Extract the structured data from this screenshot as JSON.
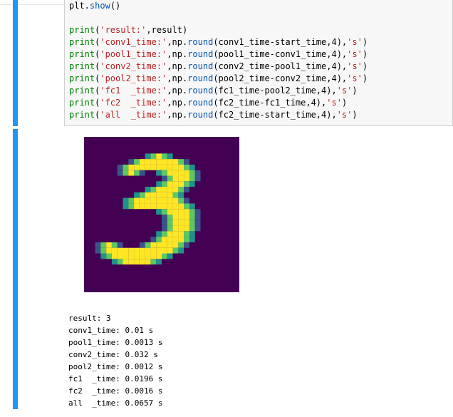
{
  "input": {
    "lines": [
      "plt.show()",
      "",
      "print('result:',result)",
      "print('conv1_time:',np.round(conv1_time-start_time,4),'s')",
      "print('pool1_time:',np.round(pool1_time-conv1_time,4),'s')",
      "print('conv2_time:',np.round(conv2_time-pool1_time,4),'s')",
      "print('pool2_time:',np.round(pool2_time-conv2_time,4),'s')",
      "print('fc1  _time:',np.round(fc1_time-pool2_time,4),'s')",
      "print('fc2  _time:',np.round(fc2_time-fc1_time,4),'s')",
      "print('all  _time:',np.round(fc2_time-start_time,4),'s')"
    ]
  },
  "output": {
    "figure": {
      "background_color": "#440154",
      "digit_label": "3"
    },
    "lines": [
      "result: 3",
      "conv1_time: 0.01 s",
      "pool1_time: 0.0013 s",
      "conv2_time: 0.032 s",
      "pool2_time: 0.0012 s",
      "fc1  _time: 0.0196 s",
      "fc2  _time: 0.0016 s",
      "all  _time: 0.0657 s"
    ]
  },
  "colors": {
    "cell_bar": "#2196f3",
    "viridis_low": "#440154",
    "viridis_mid": "#21918c",
    "viridis_high": "#fde725"
  }
}
